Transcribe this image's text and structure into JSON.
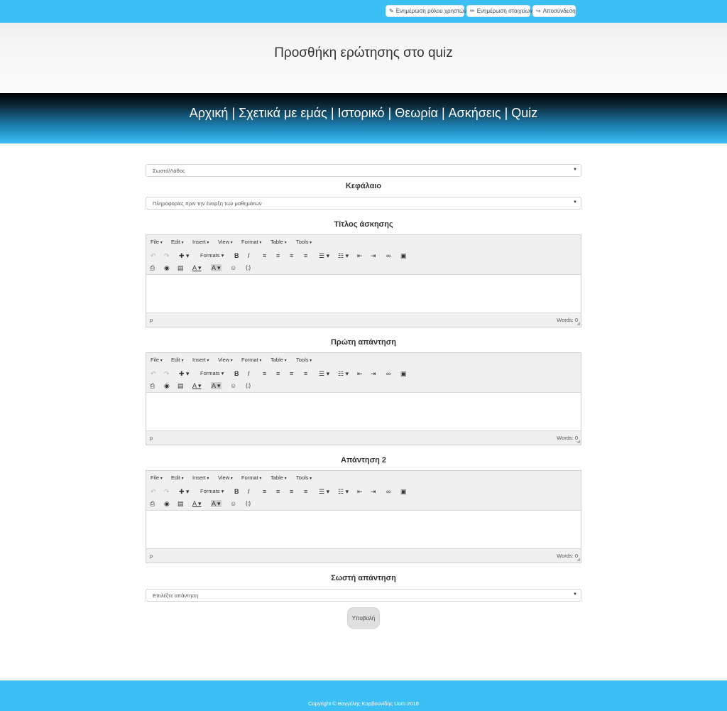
{
  "topbar": {
    "buttons": [
      {
        "icon": "wrench-icon",
        "glyph": "✎",
        "label": "Ενημέρωση ρόλου χρηστών"
      },
      {
        "icon": "pencil-icon",
        "glyph": "✏",
        "label": "Ενημέρωση στοιχείων"
      },
      {
        "icon": "logout-icon",
        "glyph": "↪",
        "label": "Αποσύνδεση"
      }
    ]
  },
  "header": {
    "title": "Προσθήκη ερώτησης στο quiz"
  },
  "nav": {
    "items": [
      "Αρχική",
      "Σχετικά με εμάς",
      "Ιστορικό",
      "Θεωρία",
      "Ασκήσεις",
      "Quiz"
    ],
    "separator": "|"
  },
  "form": {
    "type_select": {
      "value": "Σωστό/Λάθος"
    },
    "chapter_label": "Κεφάλαιο",
    "chapter_select": {
      "value": "Πληροφορίες πριν την έναρξη των μαθημάτων"
    },
    "editors": [
      {
        "label": "Τίτλος άσκησης"
      },
      {
        "label": "Πρώτη απάντηση"
      },
      {
        "label": "Απάντηση 2"
      }
    ],
    "editor_ui": {
      "menu": [
        "File",
        "Edit",
        "Insert",
        "View",
        "Format",
        "Table",
        "Tools"
      ],
      "formats_label": "Formats",
      "status_path": "p",
      "word_count": "Words: 0"
    },
    "correct_label": "Σωστή απάντηση",
    "correct_select": {
      "placeholder": "Επιλέξτε απάντηση"
    },
    "submit_label": "Υποβολή"
  },
  "footer": {
    "text": "Copyright © Βαγγέλης Καρβουνίδης Uom 2018"
  },
  "colors": {
    "accent": "#3bbff5",
    "nav_dark": "#000000",
    "editor_bg": "#f0f0f0"
  }
}
